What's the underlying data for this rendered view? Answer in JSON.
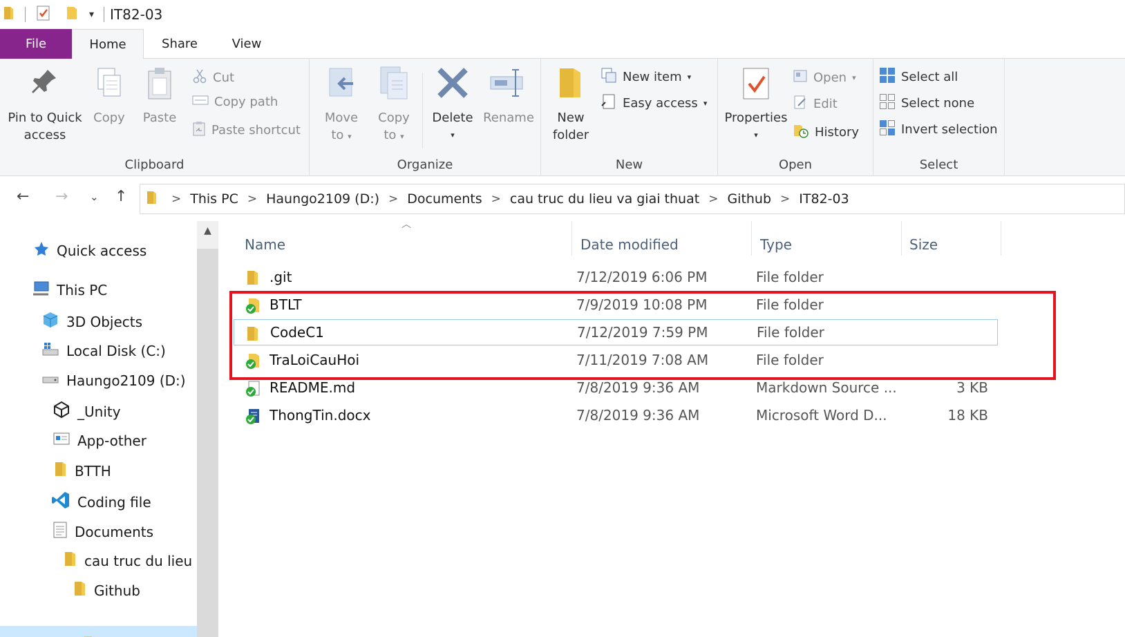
{
  "window": {
    "title": "IT82-03"
  },
  "tabs": {
    "file": "File",
    "home": "Home",
    "share": "Share",
    "view": "View"
  },
  "ribbon": {
    "clipboard": {
      "label": "Clipboard",
      "pin_line1": "Pin to Quick",
      "pin_line2": "access",
      "copy": "Copy",
      "paste": "Paste",
      "cut": "Cut",
      "copy_path": "Copy path",
      "paste_shortcut": "Paste shortcut"
    },
    "organize": {
      "label": "Organize",
      "move_line1": "Move",
      "move_line2": "to",
      "copy_line1": "Copy",
      "copy_line2": "to",
      "delete": "Delete",
      "rename": "Rename"
    },
    "new": {
      "label": "New",
      "folder_line1": "New",
      "folder_line2": "folder",
      "new_item": "New item",
      "easy_access": "Easy access"
    },
    "open": {
      "label": "Open",
      "properties": "Properties",
      "open": "Open",
      "edit": "Edit",
      "history": "History"
    },
    "select": {
      "label": "Select",
      "select_all": "Select all",
      "select_none": "Select none",
      "invert": "Invert selection"
    }
  },
  "address": {
    "crumbs": [
      "This PC",
      "Haungo2109 (D:)",
      "Documents",
      "cau truc du lieu va giai thuat",
      "Github",
      "IT82-03"
    ]
  },
  "nav": {
    "items": [
      "Quick access",
      "This PC",
      "3D Objects",
      "Local Disk (C:)",
      "Haungo2109 (D:)",
      "_Unity",
      "App-other",
      "BTTH",
      "Coding file",
      "Documents",
      "cau truc du lieu",
      "Github"
    ]
  },
  "list": {
    "headers": {
      "name": "Name",
      "date": "Date modified",
      "type": "Type",
      "size": "Size"
    },
    "rows": [
      {
        "name": ".git",
        "date": "7/12/2019 6:06 PM",
        "type": "File folder",
        "size": ""
      },
      {
        "name": "BTLT",
        "date": "7/9/2019 10:08 PM",
        "type": "File folder",
        "size": ""
      },
      {
        "name": "CodeC1",
        "date": "7/12/2019 7:59 PM",
        "type": "File folder",
        "size": ""
      },
      {
        "name": "TraLoiCauHoi",
        "date": "7/11/2019 7:08 AM",
        "type": "File folder",
        "size": ""
      },
      {
        "name": "README.md",
        "date": "7/8/2019 9:36 AM",
        "type": "Markdown Source ...",
        "size": "3 KB"
      },
      {
        "name": "ThongTin.docx",
        "date": "7/8/2019 9:36 AM",
        "type": "Microsoft Word D...",
        "size": "18 KB"
      }
    ]
  },
  "colors": {
    "file_tab": "#88258d",
    "folder": "#f2c94c",
    "highlight": "#e3141f",
    "sync_green": "#2eaa3a",
    "header_text": "#4c607a"
  }
}
